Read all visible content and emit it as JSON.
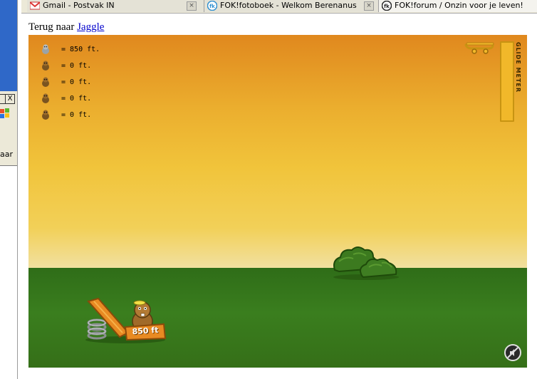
{
  "browser": {
    "tabs": [
      {
        "label": "Gmail - Postvak IN",
        "icon": "gmail-icon",
        "close": "×"
      },
      {
        "label": "FOK!fotoboek - Welkom Berenanus",
        "icon": "fok-icon",
        "close": "×"
      },
      {
        "label": "FOK!forum / Onzin voor je leven!",
        "icon": "fok-icon"
      }
    ]
  },
  "background_window": {
    "close_glyph": "X",
    "partial_label": "aar"
  },
  "page": {
    "back_text": "Terug naar",
    "back_link": "Jaggle"
  },
  "game": {
    "scores": [
      {
        "icon": "gray-beaver-icon",
        "text": "= 850 ft."
      },
      {
        "icon": "beaver-icon",
        "text": "= 0 ft."
      },
      {
        "icon": "beaver-icon",
        "text": "= 0 ft."
      },
      {
        "icon": "beaver-icon",
        "text": "= 0 ft."
      },
      {
        "icon": "beaver-icon",
        "text": "= 0 ft."
      }
    ],
    "glide_meter_label": "GLIDE METER",
    "glide_meter_level": 0,
    "sign_text": "850 ft",
    "colors": {
      "sky_top": "#e0881e",
      "sky_bottom": "#efe4b0",
      "ground": "#3a7e1e",
      "meter": "#f1b82a"
    }
  }
}
